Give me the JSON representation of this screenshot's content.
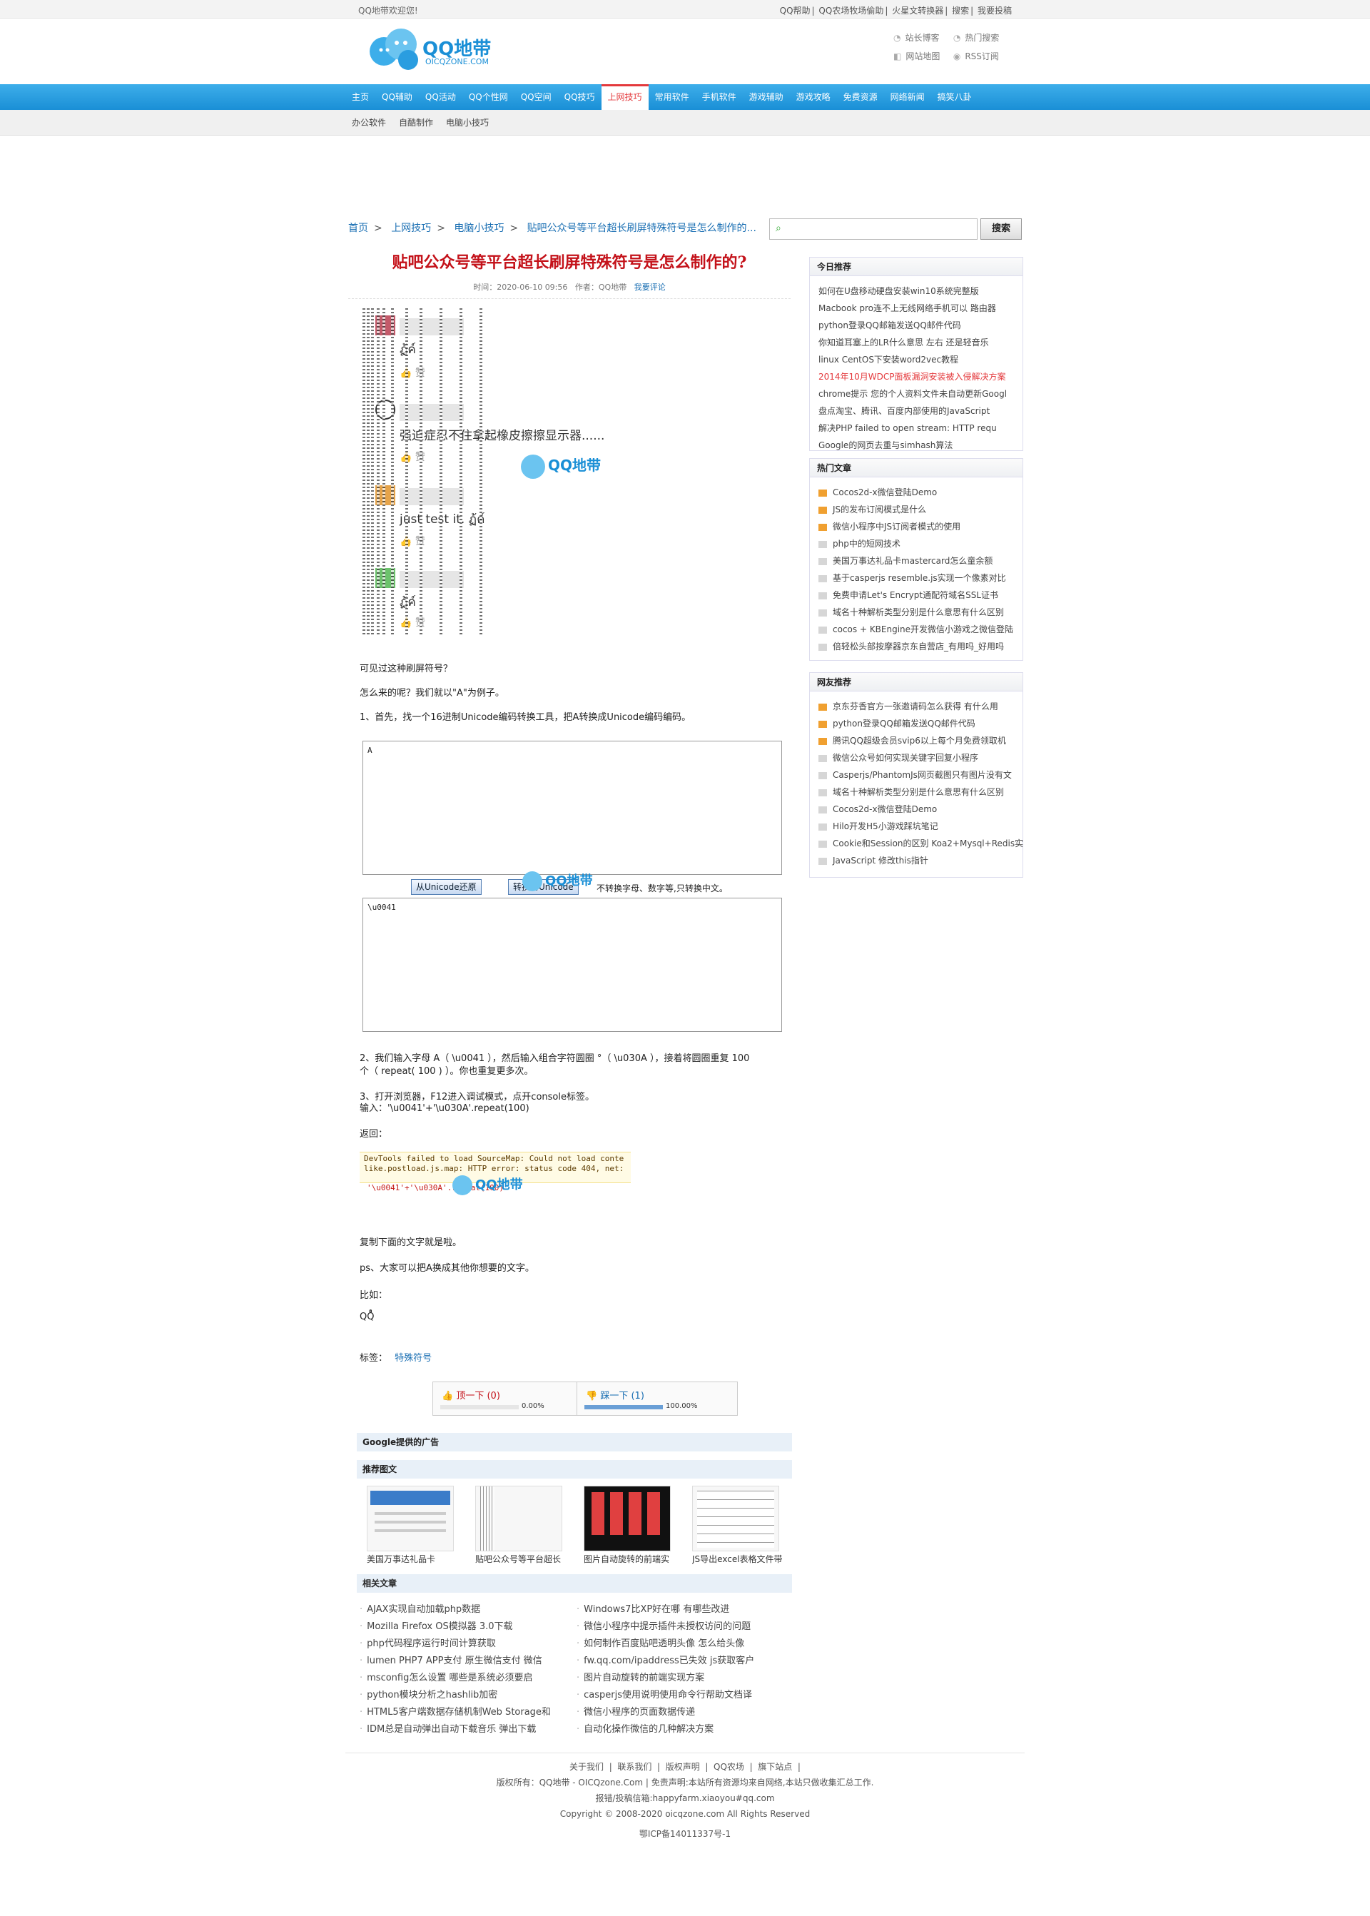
{
  "topbar": {
    "welcome": "QQ地带欢迎您!",
    "links": [
      "QQ帮助",
      "QQ农场牧场偷助",
      "火星文转换器",
      "搜索",
      "我要投稿"
    ]
  },
  "logo": {
    "text": "QQ地带",
    "sub": "OICQZONE.COM"
  },
  "header_links": [
    "站长博客",
    "热门搜索",
    "网站地图",
    "RSS订阅"
  ],
  "nav": [
    "主页",
    "QQ辅助",
    "QQ活动",
    "QQ个性网",
    "QQ空间",
    "QQ技巧",
    "上网技巧",
    "常用软件",
    "手机软件",
    "游戏辅助",
    "游戏攻略",
    "免费资源",
    "网络新闻",
    "搞笑八卦"
  ],
  "nav_active": "上网技巧",
  "subnav": [
    "办公软件",
    "自酷制作",
    "电脑小技巧"
  ],
  "breadcrumb": [
    "首页",
    "上网技巧",
    "电脑小技巧",
    "贴吧公众号等平台超长刷屏特殊符号是怎么制作的..."
  ],
  "search": {
    "placeholder": "",
    "button": "搜索"
  },
  "article": {
    "title": "贴吧公众号等平台超长刷屏特殊符号是怎么制作的?",
    "meta_time": "时间：2020-06-10 09:56",
    "meta_author": "作者：QQ地带",
    "meta_comment": "我要评论",
    "shot1": {
      "line1": "ฏ้ค์",
      "like": "赞",
      "line2": "强迫症忍不住拿起橡皮擦擦显示器......",
      "line3": "just test it. ฏ้ค์",
      "line4": "ฏ้ค์"
    },
    "p1": "可见过这种刷屏符号？",
    "p2": "怎么来的呢？我们就以\"A\"为例子。",
    "p3": "1、首先，找一个16进制Unicode编码转换工具，把A转换成Unicode编码编码。",
    "ta1_value": "A",
    "btn_restore": "从Unicode还原",
    "btn_convert": "转换为Unicode",
    "convert_note": "不转换字母、数字等,只转换中文。",
    "ta2_value": "\\u0041",
    "p4": "2、我们输入字母 A（ \\u0041 ），然后输入组合字符圆圈 °（ \\u030A ），接着将圆圈重复 100",
    "p4b": "个（ repeat( 100 ) ）。你也重复更多次。",
    "p5": "3、打开浏览器，F12进入调试模式，点开console标签。",
    "p6": "输入：'\\u0041'+'\\u030A'.repeat(100)",
    "p7": "返回：",
    "console_warn1": "DevTools failed to load SourceMap: Could not load conte",
    "console_warn2": "like.postload.js.map: HTTP error: status code 404, net:",
    "console_cmd": "'\\u0041'+'\\u030A'.repeat(100)",
    "p8": "复制下面的文字就是啦。",
    "p9": "ps、大家可以把A换成其他你想要的文字。",
    "p10": "比如：",
    "p11": "QQ̊̊",
    "tags_label": "标签：",
    "tag": "特殊符号"
  },
  "vote": {
    "up_label": "顶一下",
    "up_count": "(0)",
    "up_pct": "0.00%",
    "up_value": 0,
    "down_label": "踩一下",
    "down_count": "(1)",
    "down_pct": "100.00%",
    "down_value": 100
  },
  "ads_head": "Google提供的广告",
  "rec_head": "推荐图文",
  "rec_items": [
    "美国万事达礼品卡",
    "贴吧公众号等平台超长",
    "图片自动旋转的前端实",
    "JS导出excel表格文件带"
  ],
  "rel_head": "相关文章",
  "related_left": [
    "AJAX实现自动加载php数据",
    "Mozilla Firefox OS模拟器 3.0下载",
    "php代码程序运行时间计算获取",
    "lumen PHP7 APP支付 原生微信支付 微信",
    "msconfig怎么设置 哪些是系统必须要启",
    "python模块分析之hashlib加密",
    "HTML5客户端数据存储机制Web Storage和",
    "IDM总是自动弹出自动下载音乐 弹出下载"
  ],
  "related_right": [
    "Windows7比XP好在哪 有哪些改进",
    "微信小程序中提示插件未授权访问的问题",
    "如何制作百度贴吧透明头像 怎么给头像",
    "fw.qq.com/ipaddress已失效 js获取客户",
    "图片自动旋转的前端实现方案",
    "casperjs使用说明使用命令行帮助文档译",
    "微信小程序的页面数据传递",
    "自动化操作微信的几种解决方案"
  ],
  "sidebar": {
    "today_head": "今日推荐",
    "today": [
      "如何在U盘移动硬盘安装win10系统完整版",
      "Macbook pro连不上无线网络手机可以 路由器",
      "python登录QQ邮箱发送QQ邮件代码",
      "你知道耳塞上的LR什么意思 左右 还是轻音乐",
      "linux CentOS下安装word2vec教程",
      "2014年10月WDCP面板漏洞安装被入侵解决方案",
      "chrome提示 您的个人资料文件未自动更新Googl",
      "盘点淘宝、腾讯、百度内部使用的JavaScript",
      "解决PHP failed to open stream: HTTP requ",
      "Google的网页去重与simhash算法"
    ],
    "today_highlight": 5,
    "hot_head": "热门文章",
    "hot": [
      "Cocos2d-x微信登陆Demo",
      "JS的发布订阅模式是什么",
      "微信小程序中JS订阅者模式的使用",
      "php中的短网技术",
      "美国万事达礼品卡mastercard怎么童余额",
      "基于casperjs resemble.js实现一个像素对比",
      "免费申请Let's Encrypt通配符域名SSL证书",
      "域名十种解析类型分别是什么意思有什么区别",
      "cocos + KBEngine开发微信小游戏之微信登陆",
      "倍轻松头部按摩器京东自营店_有用吗_好用吗"
    ],
    "friend_head": "网友推荐",
    "friend": [
      "京东芬香官方一张邀请码怎么获得 有什么用",
      "python登录QQ邮箱发送QQ邮件代码",
      "腾讯QQ超级会员svip6以上每个月免费领取机",
      "微信公众号如何实现关键字回复小程序",
      "Casperjs/PhantomJs网页截图只有图片没有文",
      "域名十种解析类型分别是什么意思有什么区别",
      "Cocos2d-x微信登陆Demo",
      "Hilo开发H5小游戏踩坑笔记",
      "Cookie和Session的区别 Koa2+Mysql+Redis实",
      "JavaScript 修改this指针"
    ],
    "orange_count": 3
  },
  "footer": {
    "links": [
      "关于我们",
      "联系我们",
      "版权声明",
      "QQ农场",
      "旗下站点"
    ],
    "line2": "版权所有：QQ地带 - OICQzone.Com | 免责声明:本站所有资源均来自网络,本站只做收集汇总工作.",
    "line3": "报错/投稿信箱:happyfarm.xiaoyou#qq.com",
    "line4": "Copyright © 2008-2020 oicqzone.com All Rights Reserved",
    "line5": "鄂ICP备14011337号-1"
  },
  "colors": {
    "accent": "#1a8fd6",
    "title_red": "#c4121a",
    "link_blue": "#1a6fb3"
  }
}
